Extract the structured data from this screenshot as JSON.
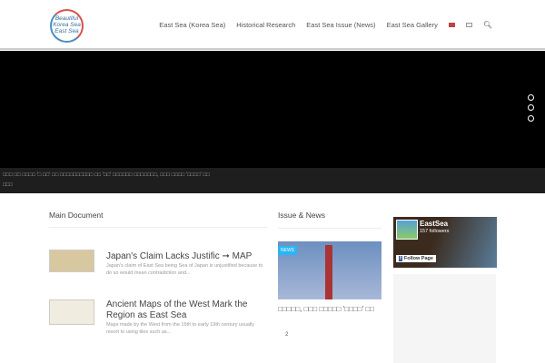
{
  "header": {
    "logo_text": "Beautiful Korea Sea East Sea",
    "nav": [
      "East Sea (Korea Sea)",
      "Historical Research",
      "East Sea Issue (News)",
      "East Sea Gallery"
    ],
    "flags": [
      "flag-us-icon",
      "flag-kr-icon"
    ],
    "search_icon": "search-icon"
  },
  "ticker": {
    "line1": "□□□ □□ □□□□ '□ □□' □□ □□□□□□□□□□ □□ '□□' □□□□□□ □□□□□□□, □□□ □□□□ '□□□□' □□",
    "line2": "□□□"
  },
  "main": {
    "title": "Main Document",
    "items": [
      {
        "title": "Japan's Claim Lacks Justific ➞ MAP",
        "desc": "Japan's claim of East Sea being Sea of Japan is unjustified because to do so would mean contradiction and..."
      },
      {
        "title": "Ancient Maps of the West Mark the Region as East Sea",
        "desc": "Maps made by the West from the 16th to early 19th century usually resort to using tiles such as..."
      }
    ]
  },
  "news": {
    "title": "Issue & News",
    "badge": "NEWS",
    "headline": "□□□□□, □□□ □□□□□ '□□□□' □□",
    "meta": "2"
  },
  "facebook": {
    "name": "EastSea",
    "followers": "157 followers",
    "button": "Follow Page"
  }
}
